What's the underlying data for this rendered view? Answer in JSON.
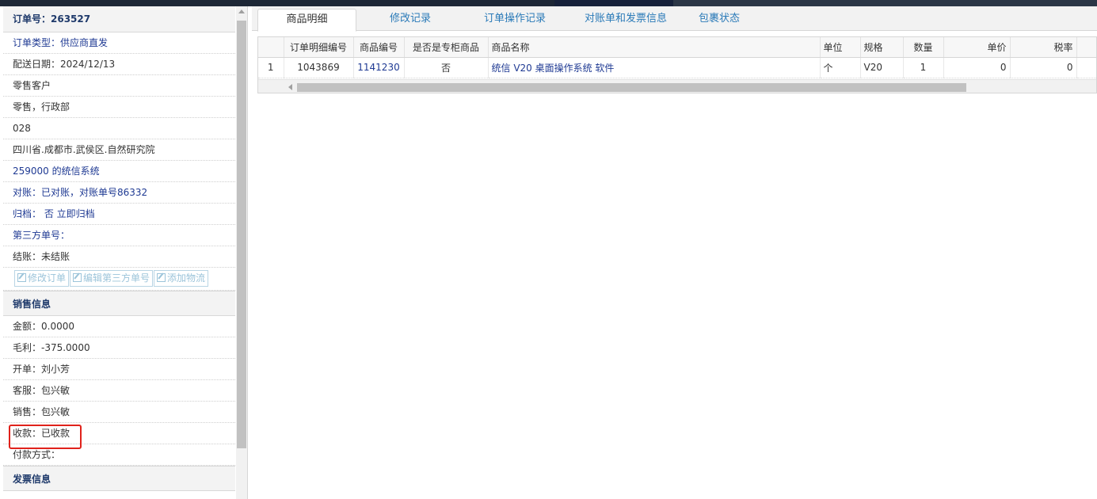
{
  "colors": {
    "accent": "#2a7ab8",
    "link": "#1f3a93",
    "highlight": "#e0221b"
  },
  "order": {
    "header": "订单号：263527",
    "rows": [
      {
        "text": "订单类型：供应商直发",
        "blue": true
      },
      {
        "text": "配送日期：2024/12/13",
        "blue": false
      },
      {
        "text": "零售客户",
        "blue": false
      },
      {
        "text": "零售，行政部",
        "blue": false
      },
      {
        "text": "028",
        "blue": false
      },
      {
        "text": "四川省.成都市.武侯区.自然研究院",
        "blue": false
      },
      {
        "text": "259000 的统信系统",
        "blue": true
      },
      {
        "text": "对账：已对账，对账单号86332",
        "blue": true
      },
      {
        "text": "归档： 否 立即归档",
        "blue": true
      },
      {
        "text": "第三方单号：",
        "blue": true
      },
      {
        "text": "结账：未结账",
        "blue": false
      }
    ],
    "buttons": [
      "修改订单",
      "编辑第三方单号",
      "添加物流"
    ]
  },
  "sales": {
    "title": "销售信息",
    "rows": [
      "金额：0.0000",
      "毛利：-375.0000",
      "开单：刘小芳",
      "客服：包兴敏",
      "销售：包兴敏",
      "收款：已收款",
      "付款方式："
    ]
  },
  "invoice": {
    "title": "发票信息"
  },
  "tabs": [
    "商品明细",
    "修改记录",
    "订单操作记录",
    "对账单和发票信息",
    "包裹状态"
  ],
  "table": {
    "columns": [
      "",
      "订单明细编号",
      "商品编号",
      "是否是专柜商品",
      "商品名称",
      "单位",
      "规格",
      "数量",
      "单价",
      "税率"
    ],
    "rows": [
      [
        "1",
        "1043869",
        "1141230",
        "否",
        "统信 V20 桌面操作系统 软件",
        "个",
        "V20",
        "1",
        "0",
        "0"
      ]
    ]
  }
}
